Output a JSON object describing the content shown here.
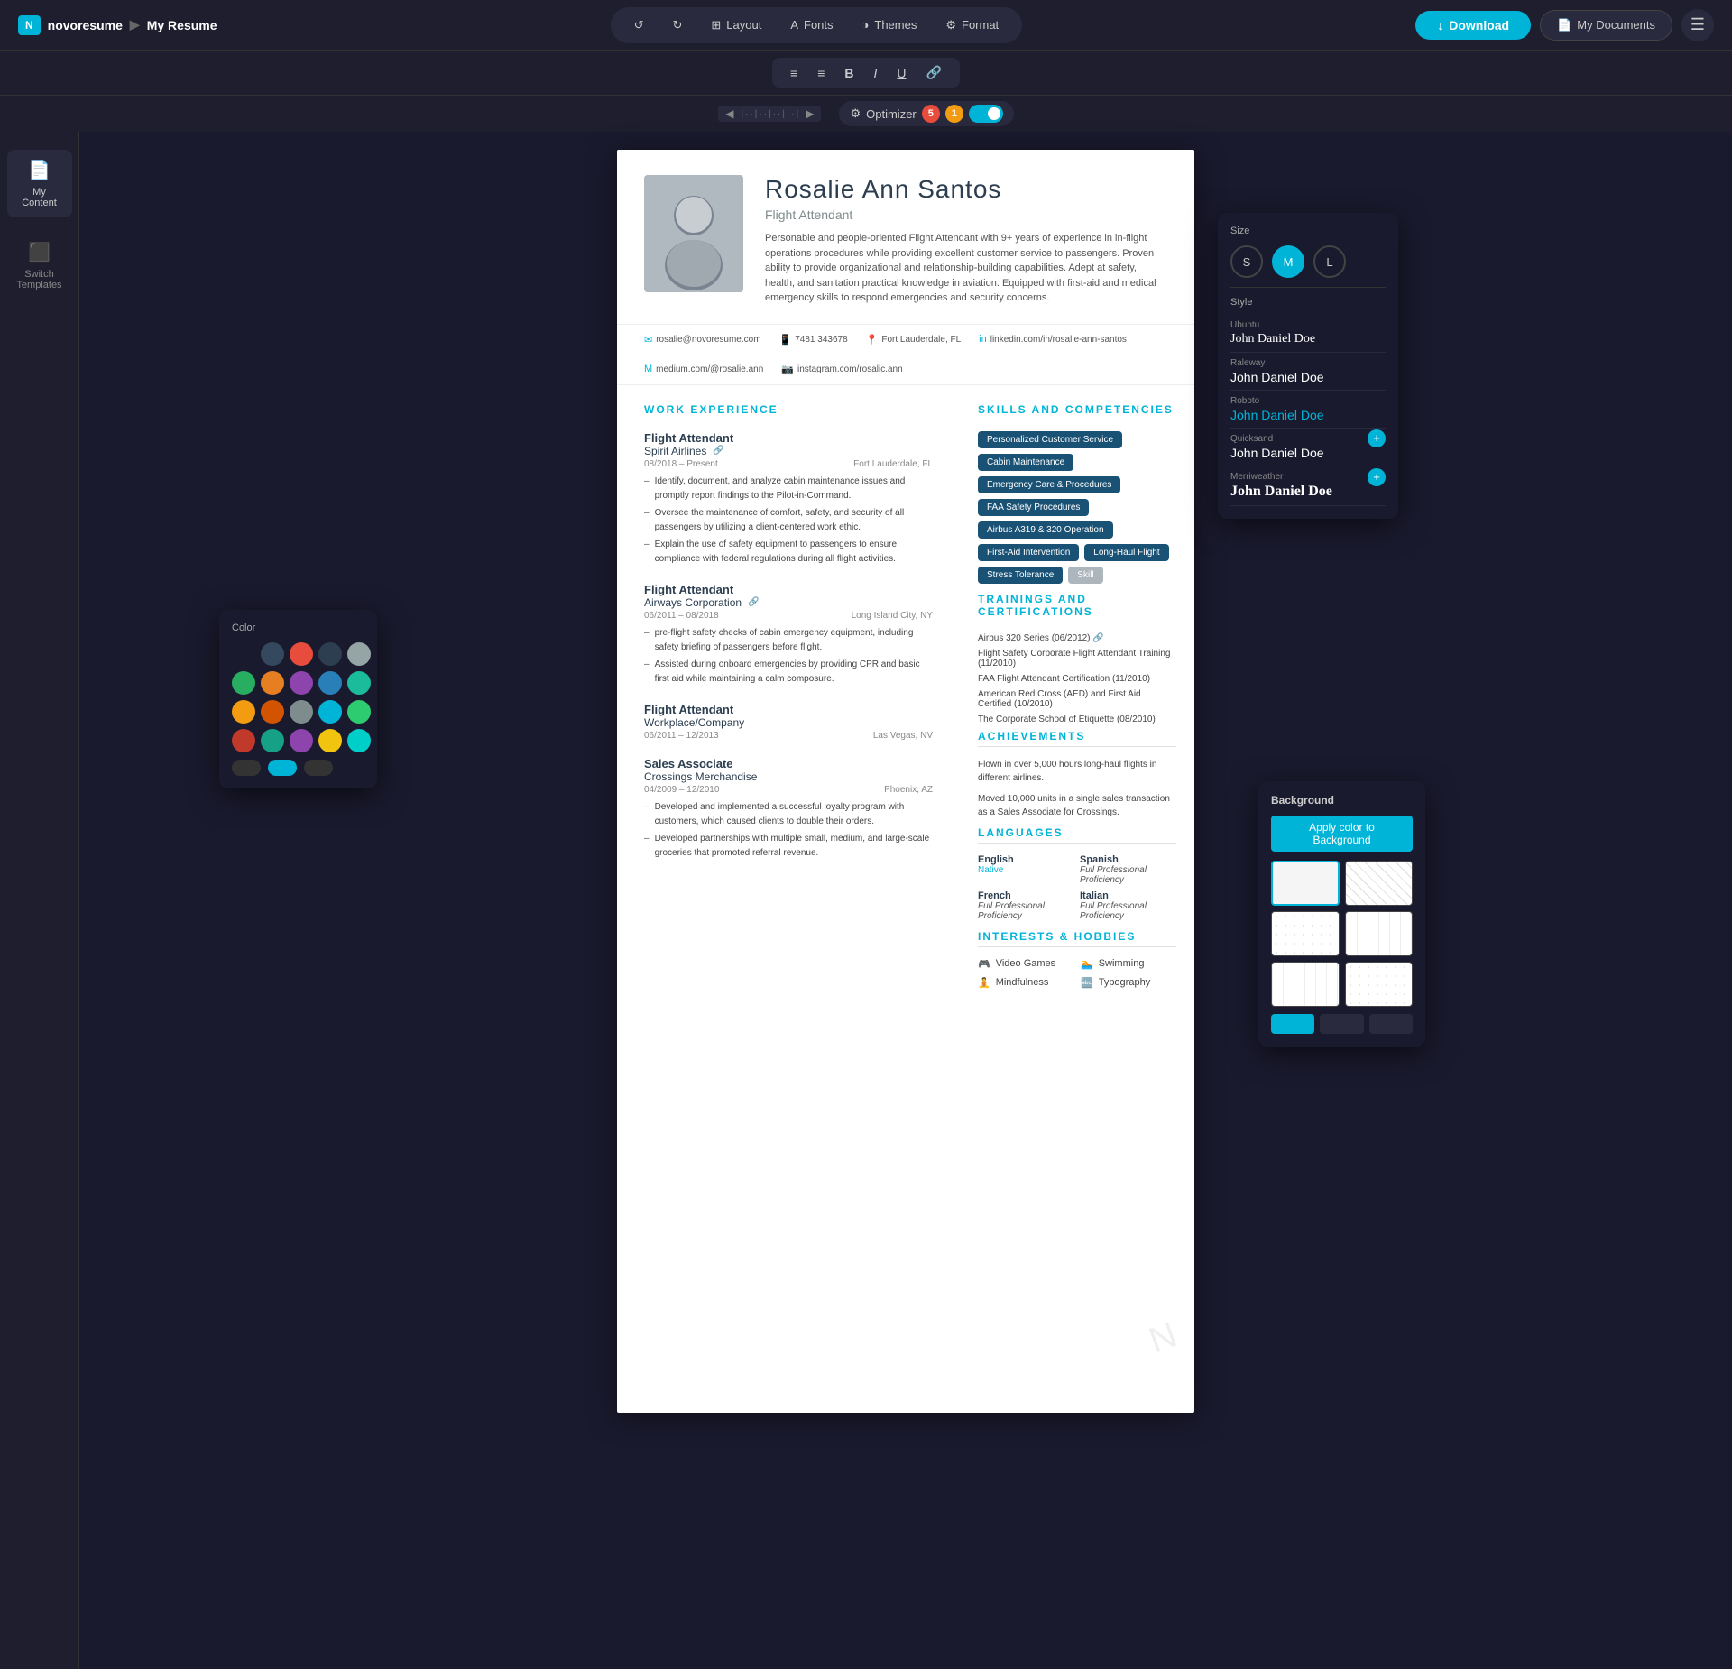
{
  "app": {
    "logo": "N",
    "brand": "novoresume",
    "breadcrumb_sep": "▶",
    "page_title": "My Resume"
  },
  "nav": {
    "undo_label": "↺",
    "redo_label": "↻",
    "layout_label": "Layout",
    "fonts_label": "Fonts",
    "themes_label": "Themes",
    "format_label": "Format",
    "download_label": "Download",
    "my_docs_label": "My Documents"
  },
  "toolbar": {
    "align_left": "≡",
    "align_center": "≡",
    "bold": "B",
    "italic": "I",
    "underline": "U",
    "link": "🔗"
  },
  "optimizer": {
    "label": "Optimizer",
    "icon": "⚙",
    "count1": "5",
    "count2": "1"
  },
  "sidebar": {
    "items": [
      {
        "icon": "📄",
        "label": "My Content"
      },
      {
        "icon": "⬛",
        "label": "Switch Templates"
      }
    ]
  },
  "resume": {
    "name": "Rosalie Ann Santos",
    "title": "Flight Attendant",
    "summary": "Personable and people-oriented Flight Attendant with 9+ years of experience in in-flight operations procedures while providing excellent customer service to passengers. Proven ability to provide organizational and relationship-building capabilities. Adept at safety, health, and sanitation practical knowledge in aviation. Equipped with first-aid and medical emergency skills to respond emergencies and security concerns.",
    "contact": {
      "email": "rosalie@novoresume.com",
      "phone": "7481 343678",
      "location": "Fort Lauderdale, FL",
      "linkedin": "linkedin.com/in/rosalie-ann-santos",
      "blog": "medium.com/@rosalie.ann",
      "instagram": "instagram.com/rosalic.ann"
    },
    "work_experience": {
      "section_title": "WORK EXPERIENCE",
      "jobs": [
        {
          "title": "Flight Attendant",
          "company": "Spirit Airlines",
          "date_range": "08/2018 – Present",
          "location": "Fort Lauderdale, FL",
          "bullets": [
            "Identify, document, and analyze cabin maintenance issues and promptly report findings to the Pilot-in-Command.",
            "Oversee the maintenance of comfort, safety, and security of all passengers by utilizing a client-centered work ethic.",
            "Explain the use of safety equipment to passengers to ensure compliance with federal regulations during all flight activities."
          ]
        },
        {
          "title": "Flight Attendant",
          "company": "Airways Corporation",
          "date_range": "06/2011 – 08/2018",
          "location": "Long Island City, NY",
          "bullets": [
            "pre-flight safety checks of cabin emergency equipment, including safety briefing of passengers before flight.",
            "Assisted during onboard emergencies by providing CPR and basic first aid while maintaining a calm composure."
          ]
        },
        {
          "title": "Flight Attendant",
          "company": "Workplace/Company",
          "date_range": "06/2011 – 12/2013",
          "location": "Las Vegas, NV",
          "bullets": []
        },
        {
          "title": "Sales Associate",
          "company": "Crossings Merchandise",
          "date_range": "04/2009 – 12/2010",
          "location": "Phoenix, AZ",
          "bullets": [
            "Developed and implemented a successful loyalty program with customers, which caused clients to double their orders.",
            "Developed partnerships with multiple small, medium, and large-scale groceries that promoted referral revenue."
          ]
        }
      ]
    },
    "skills": {
      "section_title": "SKILLS AND COMPETENCIES",
      "tags": [
        "Personalized Customer Service",
        "Cabin Maintenance",
        "Emergency Care & Procedures",
        "FAA Safety Procedures",
        "Airbus A319 & 320 Operation",
        "First-Aid Intervention",
        "Long-Haul Flight",
        "Stress Tolerance",
        "Skill"
      ]
    },
    "trainings": {
      "section_title": "TRAININGS AND CERTIFICATIONS",
      "items": [
        "Airbus 320 Series (06/2012) 🔗",
        "Flight Safety Corporate Flight Attendant Training (11/2010)",
        "FAA Flight Attendant Certification (11/2010)",
        "American Red Cross (AED) and First Aid Certified (10/2010)",
        "The Corporate School of Etiquette (08/2010)"
      ]
    },
    "achievements": {
      "section_title": "ACHIEVEMENTS",
      "items": [
        "Flown in over 5,000 hours long-haul flights in different airlines.",
        "Moved 10,000 units in a single sales transaction as a Sales Associate for Crossings."
      ]
    },
    "languages": {
      "section_title": "LANGUAGES",
      "items": [
        {
          "name": "English",
          "level": "Native"
        },
        {
          "name": "Spanish",
          "level": "Full Professional Proficiency"
        },
        {
          "name": "French",
          "level": "Full Professional Proficiency"
        },
        {
          "name": "Italian",
          "level": "Full Professional Proficiency"
        }
      ]
    },
    "interests": {
      "section_title": "INTERESTS & HOBBIES",
      "items": [
        {
          "icon": "🎮",
          "label": "Video Games"
        },
        {
          "icon": "🏊",
          "label": "Swimming"
        },
        {
          "icon": "🧘",
          "label": "Mindfulness"
        },
        {
          "icon": "🔤",
          "label": "Typography"
        }
      ]
    }
  },
  "size_panel": {
    "title": "Size",
    "sizes": [
      "S",
      "M",
      "L"
    ],
    "active": "M",
    "style_title": "Style",
    "fonts": [
      {
        "name": "Ubuntu",
        "sample": "John Daniel Doe",
        "style": "ubuntu"
      },
      {
        "name": "Raleway",
        "sample": "John Daniel Doe",
        "style": "raleway"
      },
      {
        "name": "Roboto",
        "sample": "John Daniel Doe",
        "style": "roboto",
        "active": true
      },
      {
        "name": "Quicksand",
        "sample": "John Daniel Doe",
        "style": "quicksand"
      },
      {
        "name": "Merriweather",
        "sample": "John Daniel Doe",
        "style": "merriweather"
      }
    ]
  },
  "color_panel": {
    "title": "Color",
    "swatches": [
      "#1a1a2e",
      "#34495e",
      "#e74c3c",
      "#2c3e50",
      "#95a5a6",
      "#27ae60",
      "#e67e22",
      "#8e44ad",
      "#2980b9",
      "#1abc9c",
      "#f39c12",
      "#d35400",
      "#7f8c8d",
      "#00b4d8",
      "#2ecc71",
      "#c0392b",
      "#16a085",
      "#8e44ad",
      "#f1c40f",
      "#00cec9"
    ],
    "toggles": [
      false,
      true,
      false
    ]
  },
  "bg_panel": {
    "title": "Background",
    "apply_btn": "Apply color to Background",
    "options": [
      "plain",
      "pattern1",
      "pattern2",
      "pattern3",
      "pattern3",
      "pattern2"
    ],
    "active_option": 0
  }
}
